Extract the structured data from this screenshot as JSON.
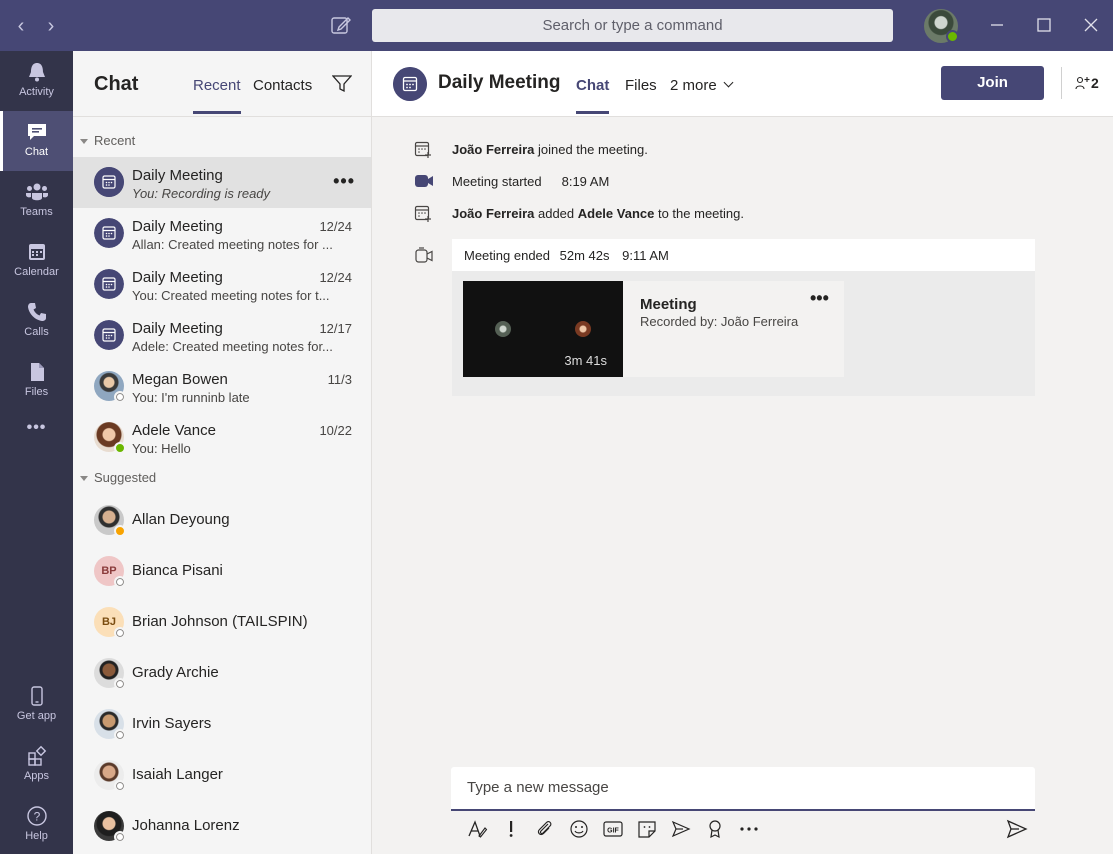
{
  "titlebar": {
    "search_placeholder": "Search or type a command",
    "back_icon": "chevron-left-icon",
    "forward_icon": "chevron-right-icon",
    "compose_icon": "new-chat-icon",
    "window_controls": [
      "minimize-icon",
      "maximize-icon",
      "close-icon"
    ]
  },
  "rail": {
    "items": [
      {
        "label": "Activity",
        "icon": "bell-icon"
      },
      {
        "label": "Chat",
        "icon": "chat-icon"
      },
      {
        "label": "Teams",
        "icon": "teams-icon"
      },
      {
        "label": "Calendar",
        "icon": "calendar-icon"
      },
      {
        "label": "Calls",
        "icon": "phone-icon"
      },
      {
        "label": "Files",
        "icon": "file-icon"
      },
      {
        "label": "Get app",
        "icon": "mobile-icon"
      },
      {
        "label": "Apps",
        "icon": "apps-icon"
      },
      {
        "label": "Help",
        "icon": "help-icon"
      }
    ],
    "more": "•••"
  },
  "chat_list": {
    "title": "Chat",
    "tabs": [
      "Recent",
      "Contacts"
    ],
    "recent_label": "Recent",
    "suggested_label": "Suggested",
    "recent": [
      {
        "name": "Daily Meeting",
        "preview": "You: Recording is ready",
        "date": "",
        "more": "•••"
      },
      {
        "name": "Daily Meeting",
        "preview": "Allan: Created meeting notes for ...",
        "date": "12/24"
      },
      {
        "name": "Daily Meeting",
        "preview": "You: Created meeting notes for t...",
        "date": "12/24"
      },
      {
        "name": "Daily Meeting",
        "preview": "Adele: Created meeting notes for...",
        "date": "12/17"
      },
      {
        "name": "Megan Bowen",
        "preview": "You: I'm runninb late",
        "date": "11/3"
      },
      {
        "name": "Adele Vance",
        "preview": "You: Hello",
        "date": "10/22"
      }
    ],
    "suggested": [
      {
        "name": "Allan Deyoung"
      },
      {
        "name": "Bianca Pisani",
        "initials": "BP"
      },
      {
        "name": "Brian Johnson (TAILSPIN)",
        "initials": "BJ"
      },
      {
        "name": "Grady Archie"
      },
      {
        "name": "Irvin Sayers"
      },
      {
        "name": "Isaiah Langer"
      },
      {
        "name": "Johanna Lorenz"
      }
    ]
  },
  "main": {
    "title": "Daily Meeting",
    "tabs": [
      "Chat",
      "Files",
      "2 more"
    ],
    "join_label": "Join",
    "participants_count": "2",
    "events": [
      {
        "actor": "João Ferreira",
        "text": " joined the meeting."
      },
      {
        "text": "Meeting started",
        "time": "8:19 AM"
      },
      {
        "actor": "João Ferreira",
        "text": " added ",
        "target": "Adele Vance",
        "suffix": " to the meeting."
      }
    ],
    "ended": {
      "label": "Meeting ended",
      "duration": "52m 42s",
      "time": "9:11 AM"
    },
    "recording": {
      "title": "Meeting",
      "subtitle": "Recorded by: João Ferreira",
      "duration": "3m 41s",
      "more": "•••"
    },
    "compose_placeholder": "Type a new message"
  },
  "colors": {
    "brand": "#464775",
    "rail": "#33344a",
    "available": "#6bb700",
    "away": "#f8a300"
  }
}
